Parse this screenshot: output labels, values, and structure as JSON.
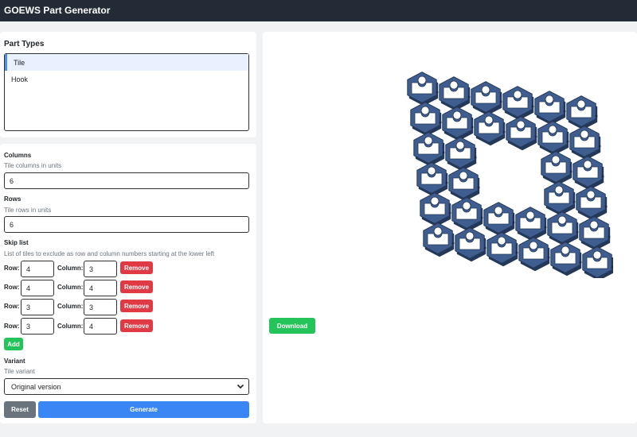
{
  "app": {
    "title": "GOEWS Part Generator"
  },
  "part_types": {
    "title": "Part Types",
    "items": [
      {
        "label": "Tile",
        "selected": true
      },
      {
        "label": "Hook",
        "selected": false
      }
    ]
  },
  "columns": {
    "label": "Columns",
    "help": "Tile columns in units",
    "value": "6"
  },
  "rows": {
    "label": "Rows",
    "help": "Tile rows in units",
    "value": "6"
  },
  "skip_list": {
    "label": "Skip list",
    "help": "List of tiles to exclude as row and column numbers starting at the lower left",
    "row_label": "Row:",
    "column_label": "Column:",
    "remove_label": "Remove",
    "add_label": "Add",
    "entries": [
      {
        "row": "4",
        "column": "3"
      },
      {
        "row": "4",
        "column": "4"
      },
      {
        "row": "3",
        "column": "3"
      },
      {
        "row": "3",
        "column": "4"
      }
    ]
  },
  "variant": {
    "label": "Variant",
    "help": "Tile variant",
    "selected": "Original version"
  },
  "actions": {
    "reset_label": "Reset",
    "generate_label": "Generate",
    "download_label": "Download"
  },
  "preview": {
    "tile_color": "#3f5e8f",
    "tile_edge": "#24395a",
    "grid_columns": 6,
    "grid_rows": 6,
    "skipped": [
      [
        4,
        3
      ],
      [
        4,
        4
      ],
      [
        3,
        3
      ],
      [
        3,
        4
      ]
    ]
  }
}
